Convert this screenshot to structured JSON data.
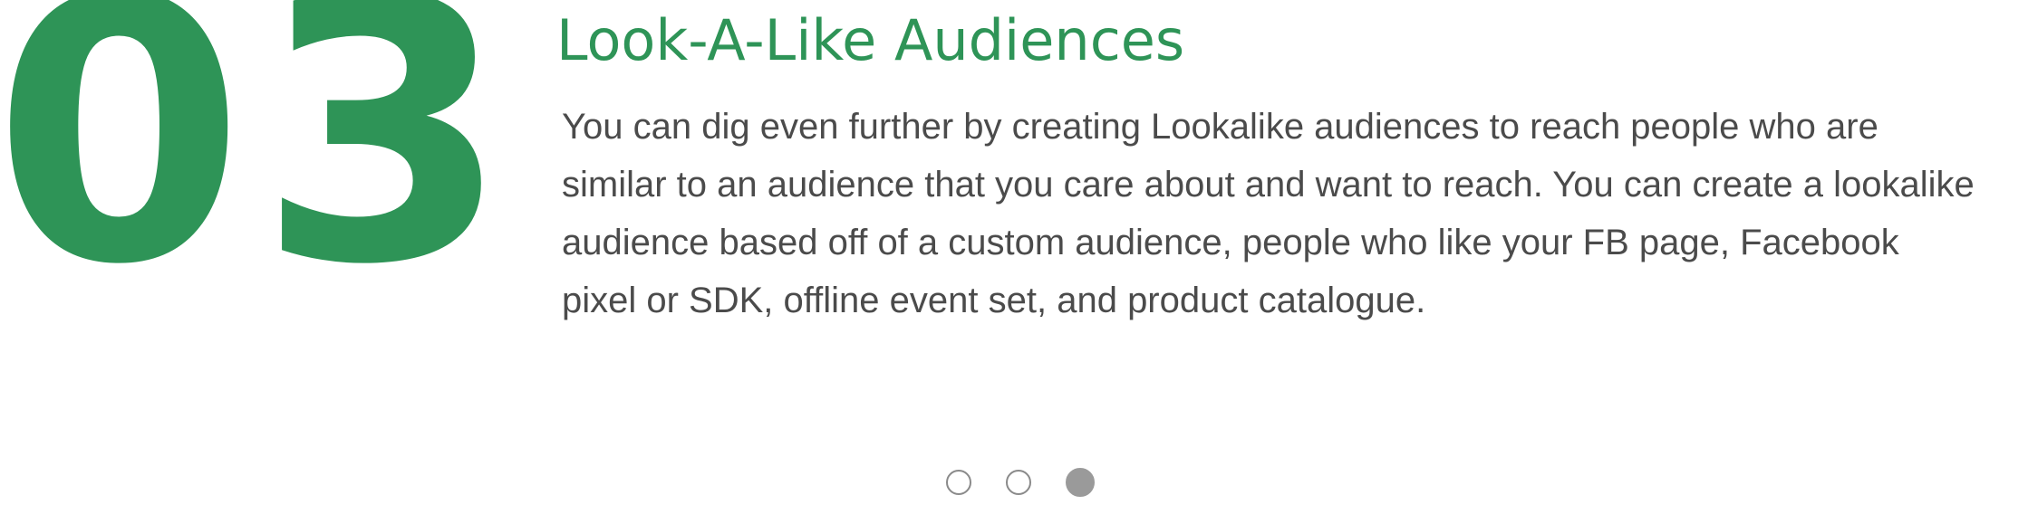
{
  "slide": {
    "number": "03",
    "title": "Look-A-Like Audiences",
    "description": "You can dig even further by creating Lookalike audiences to reach people who are similar to an audience that you care about and want to reach. You can create a lookalike audience based off of a custom audience, people who like your FB page, Facebook pixel or SDK, offline event set, and product catalogue."
  },
  "pager": {
    "total": 3,
    "active_index": 2
  },
  "colors": {
    "accent": "#2e9457",
    "body_text": "#4b4b4b",
    "dot_active": "#9a9a9a",
    "dot_border": "#8a8a8a"
  }
}
